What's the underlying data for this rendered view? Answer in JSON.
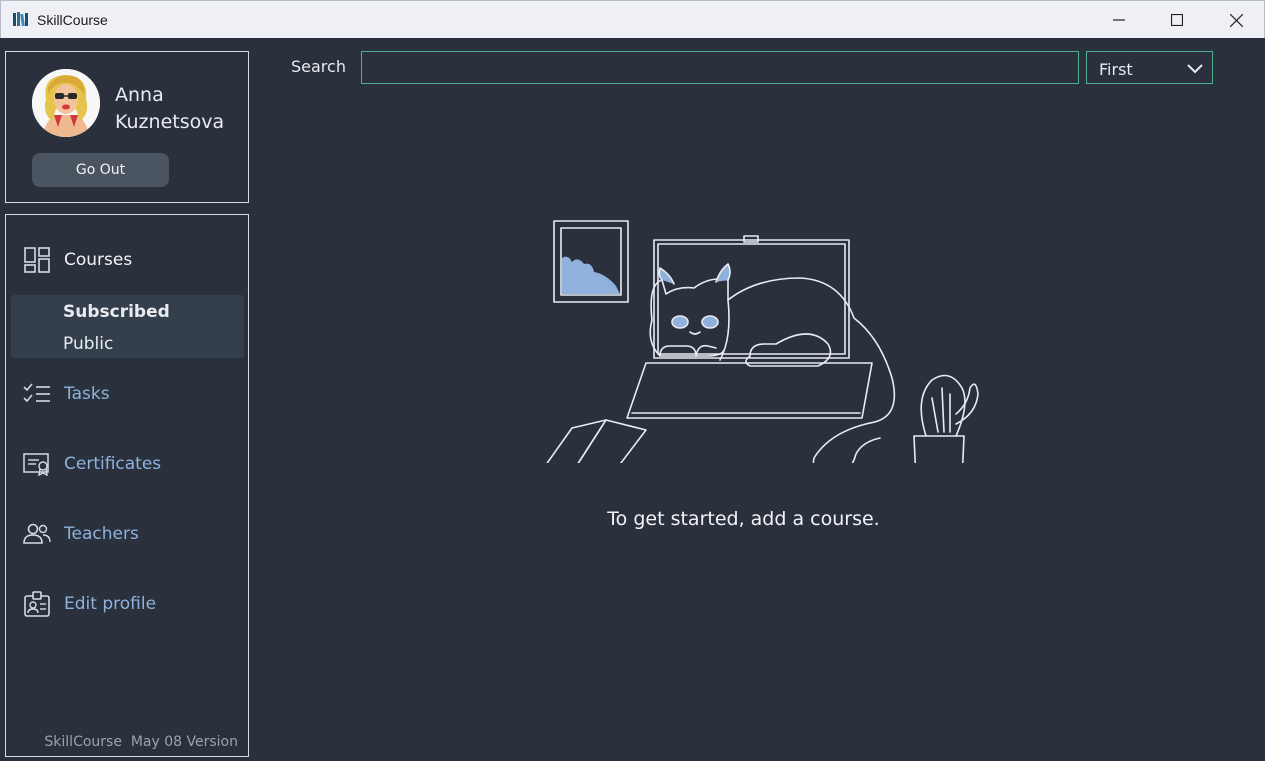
{
  "window": {
    "title": "SkillCourse",
    "minimize_icon": "minimize-icon",
    "maximize_icon": "maximize-icon",
    "close_icon": "close-icon"
  },
  "profile": {
    "first_name": "Anna",
    "last_name": "Kuznetsova",
    "go_out_label": "Go Out"
  },
  "nav": {
    "courses": {
      "label": "Courses",
      "icon": "grid-icon"
    },
    "subnav": [
      {
        "label": "Subscribed",
        "selected": true
      },
      {
        "label": "Public",
        "selected": false
      }
    ],
    "tasks": {
      "label": "Tasks",
      "icon": "checklist-icon"
    },
    "certificates": {
      "label": "Certificates",
      "icon": "certificate-icon"
    },
    "teachers": {
      "label": "Teachers",
      "icon": "people-icon"
    },
    "edit_profile": {
      "label": "Edit profile",
      "icon": "id-badge-icon"
    }
  },
  "footer": {
    "version": "SkillCourse  May 08 Version"
  },
  "search": {
    "label": "Search",
    "value": "",
    "filter_value": "First"
  },
  "main": {
    "empty_message": "To get started, add a course."
  },
  "colors": {
    "background": "#2a313d",
    "accent_border": "#4fb08d",
    "link": "#8fb1db",
    "selected_bg": "#343f4d",
    "illustration_fill": "#8fb1db"
  }
}
